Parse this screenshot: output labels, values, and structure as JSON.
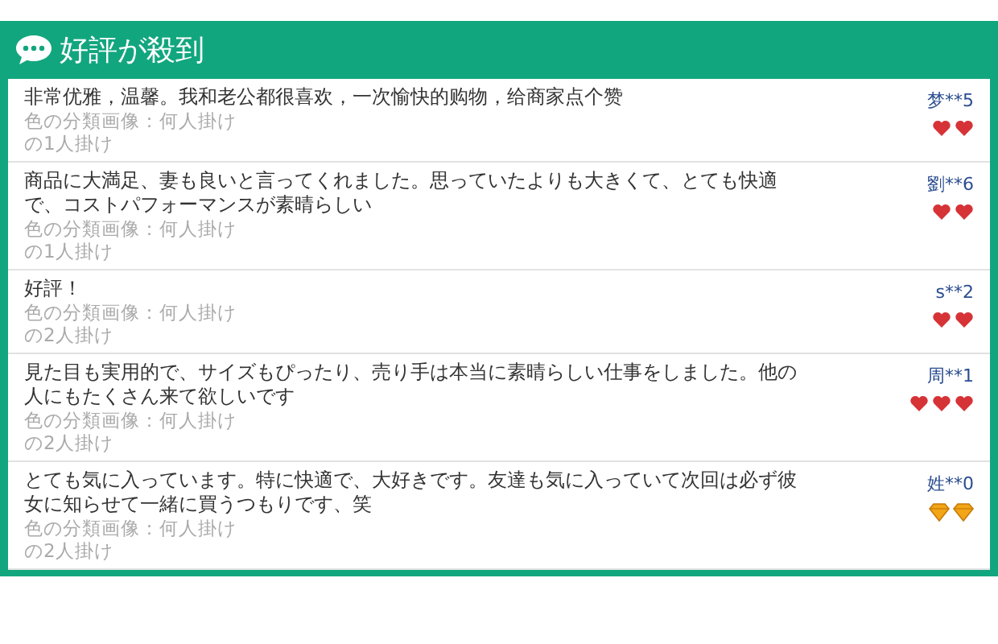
{
  "header": {
    "title": "好評が殺到"
  },
  "reviews": [
    {
      "comment": "非常优雅，温馨。我和老公都很喜欢，一次愉快的购物，给商家点个赞",
      "variant": "色の分類画像：何人掛け",
      "size": "の1人掛け",
      "user": "梦**5",
      "badges": [
        {
          "kind": "heart"
        },
        {
          "kind": "heart"
        }
      ]
    },
    {
      "comment": "商品に大満足、妻も良いと言ってくれました。思っていたよりも大きくて、とても快適で、コストパフォーマンスが素晴らしい",
      "variant": "色の分類画像：何人掛け",
      "size": "の1人掛け",
      "user": "劉**6",
      "badges": [
        {
          "kind": "heart"
        },
        {
          "kind": "heart"
        }
      ]
    },
    {
      "comment": "好評！",
      "variant": "色の分類画像：何人掛け",
      "size": "の2人掛け",
      "user": "s**2",
      "badges": [
        {
          "kind": "heart"
        },
        {
          "kind": "heart"
        }
      ]
    },
    {
      "comment": "見た目も実用的で、サイズもぴったり、売り手は本当に素晴らしい仕事をしました。他の人にもたくさん来て欲しいです",
      "variant": "色の分類画像：何人掛け",
      "size": "の2人掛け",
      "user": "周**1",
      "badges": [
        {
          "kind": "heart"
        },
        {
          "kind": "heart"
        },
        {
          "kind": "heart"
        }
      ]
    },
    {
      "comment": "とても気に入っています。特に快適で、大好きです。友達も気に入っていて次回は必ず彼女に知らせて一緒に買うつもりです、笑",
      "variant": "色の分類画像：何人掛け",
      "size": "の2人掛け",
      "user": "姓**0",
      "badges": [
        {
          "kind": "diamond"
        },
        {
          "kind": "diamond"
        }
      ]
    }
  ]
}
